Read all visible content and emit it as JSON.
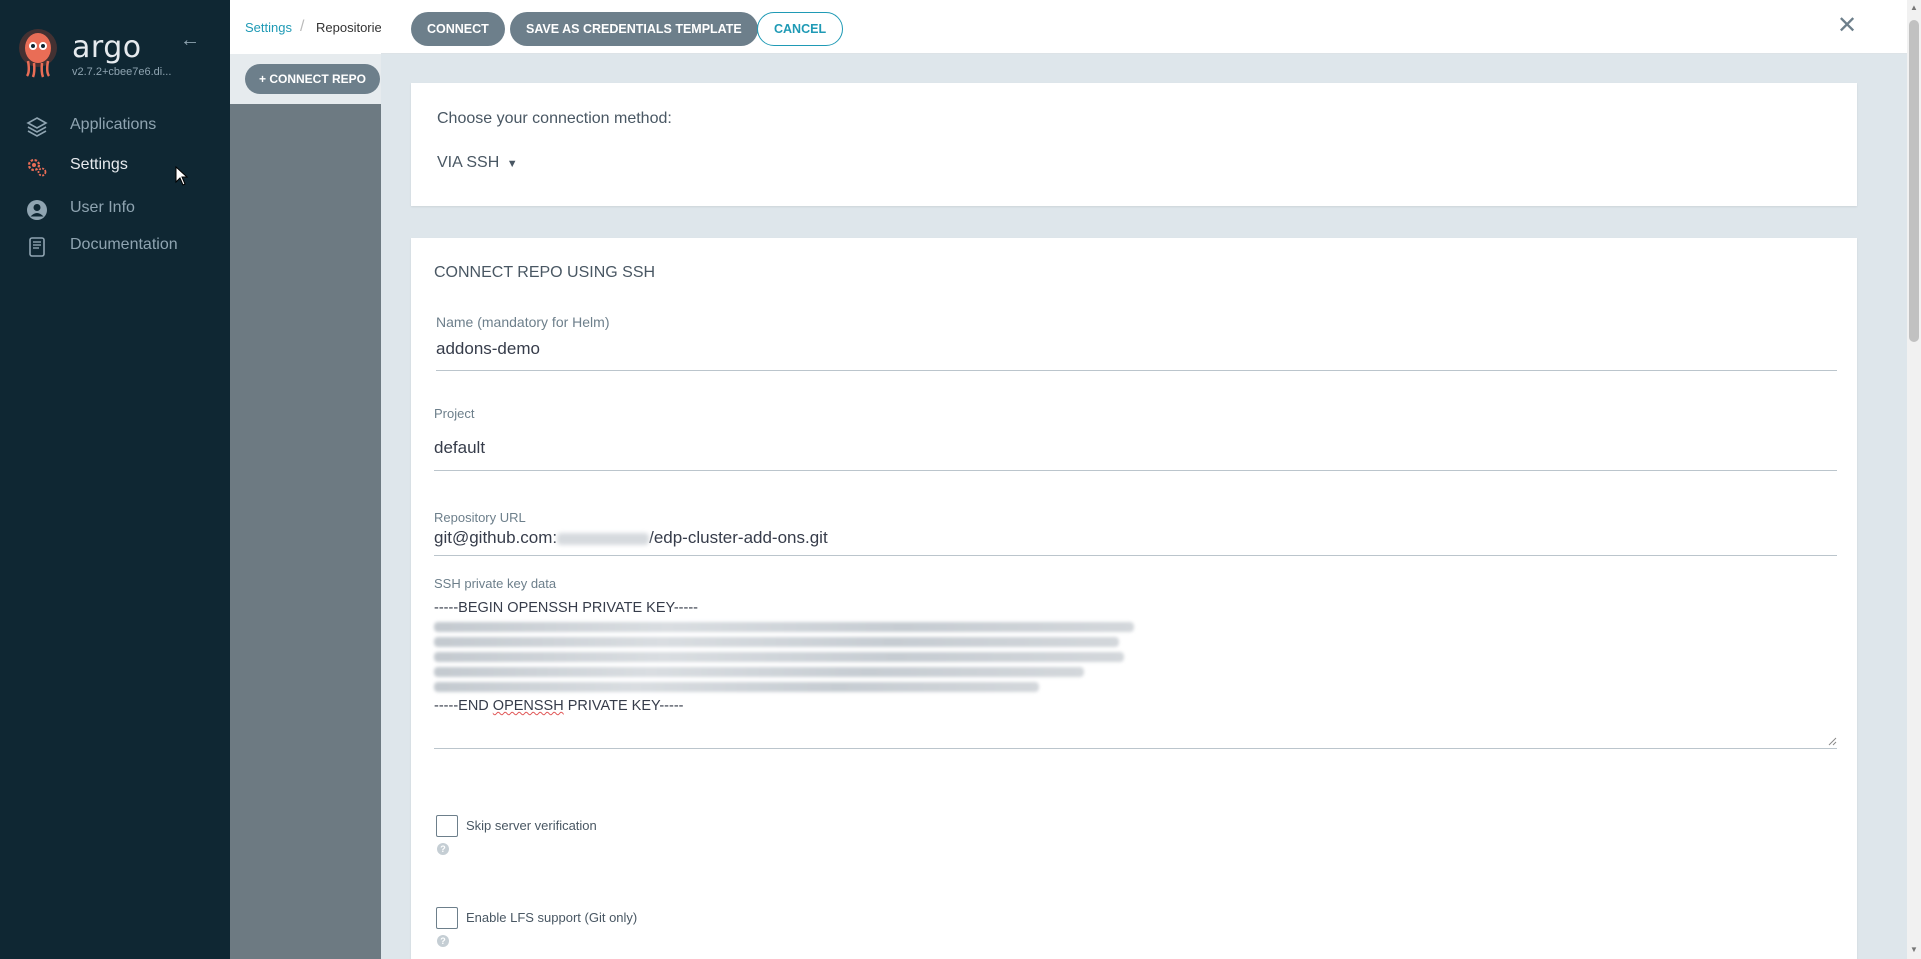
{
  "sidebar": {
    "brand": "argo",
    "version": "v2.7.2+cbee7e6.di...",
    "items": [
      {
        "label": "Applications",
        "icon": "layers-icon"
      },
      {
        "label": "Settings",
        "icon": "gears-icon"
      },
      {
        "label": "User Info",
        "icon": "user-icon"
      },
      {
        "label": "Documentation",
        "icon": "book-icon"
      }
    ]
  },
  "breadcrumb": {
    "first": "Settings",
    "second": "Repositorie"
  },
  "underlay": {
    "connect_repo_label": "CONNECT REPO"
  },
  "panel": {
    "connect_label": "CONNECT",
    "save_template_label": "SAVE AS CREDENTIALS TEMPLATE",
    "cancel_label": "CANCEL",
    "method_prompt": "Choose your connection method:",
    "method_value": "VIA SSH",
    "section_title": "CONNECT REPO USING SSH",
    "name": {
      "label": "Name (mandatory for Helm)",
      "value": "addons-demo"
    },
    "project": {
      "label": "Project",
      "value": "default"
    },
    "repo_url": {
      "label": "Repository URL",
      "prefix": "git@github.com:",
      "suffix": "/edp-cluster-add-ons.git"
    },
    "ssh_key": {
      "label": "SSH private key data",
      "begin": "-----BEGIN OPENSSH PRIVATE KEY-----",
      "end_prefix": "-----END ",
      "end_word": "OPENSSH",
      "end_suffix": " PRIVATE KEY-----"
    },
    "skip_verification_label": "Skip server verification",
    "lfs_label": "Enable LFS support (Git only)",
    "help_glyph": "?"
  },
  "colors": {
    "sidebar_bg": "#0f2733",
    "accent": "#1f9ab5",
    "button_dark": "#6d7f8b",
    "settings_icon": "#e96d56"
  }
}
